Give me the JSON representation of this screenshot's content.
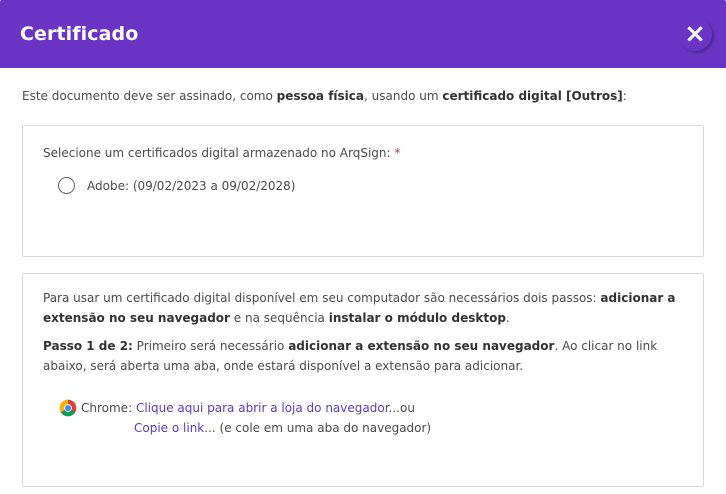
{
  "modal": {
    "title": "Certificado",
    "close_icon": "×",
    "accent_color": "#6a35c4"
  },
  "intro": {
    "t1": "Este documento deve ser assinado, como ",
    "b1": "pessoa física",
    "t2": ", usando um ",
    "b2": "certificado digital [Outros]",
    "t3": ":"
  },
  "selection": {
    "label": "Selecione um certificados digital armazenado no ArqSign: ",
    "required_mark": "*",
    "options": [
      {
        "label": "Adobe: (09/02/2023 a 09/02/2028)",
        "selected": false
      }
    ]
  },
  "steps": {
    "p1_t1": "Para usar um certificado digital disponível em seu computador são necessários dois passos: ",
    "p1_b1": "adicionar a extensão no seu navegador",
    "p1_t2": " e na sequência ",
    "p1_b2": "instalar o módulo desktop",
    "p1_t3": ".",
    "p2_b0": "Passo 1 de 2:",
    "p2_t1": "  Primeiro será necessário ",
    "p2_b1": "adicionar a extensão no seu navegador",
    "p2_t2": ". Ao clicar no link abaixo, será aberta uma aba, onde estará disponível a extensão para adicionar.",
    "browser_label": "Chrome:",
    "store_link": "Clique aqui para abrir a loja do navegador...",
    "ou": " ou",
    "copy_link": "Copie o link...",
    "copy_hint": " (e cole em uma aba do navegador)",
    "browser_icon": "chrome-icon"
  }
}
